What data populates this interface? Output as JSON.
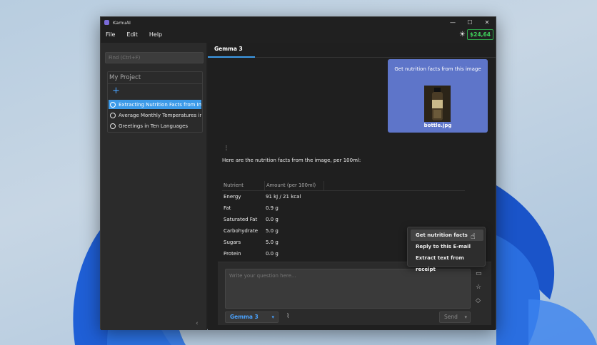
{
  "app": {
    "title": "KamuAI",
    "menu": [
      "File",
      "Edit",
      "Help"
    ],
    "credit": "$24,64",
    "accent_color": "#3d9be9",
    "credit_color": "#3fd35c"
  },
  "window_controls": {
    "minimize": "—",
    "maximize": "☐",
    "close": "✕"
  },
  "sidebar": {
    "search_placeholder": "Find (Ctrl+F)",
    "project_title": "My Project",
    "add_label": "+",
    "chats": [
      {
        "label": "Extracting Nutrition Facts from Im",
        "active": true
      },
      {
        "label": "Average Monthly Temperatures in",
        "active": false
      },
      {
        "label": "Greetings in Ten Languages",
        "active": false
      }
    ],
    "collapse_icon": "chevron-left-icon"
  },
  "tab": {
    "label": "Gemma 3"
  },
  "conversation": {
    "user_message": "Get nutrition facts from this image",
    "attachment_name": "bottle.jpg",
    "ai_intro": "Here are the nutrition facts from the image, per 100ml:",
    "table_headers": [
      "Nutrient",
      "Amount (per 100ml)"
    ],
    "table_rows": [
      [
        "Energy",
        "91 kJ / 21 kcal"
      ],
      [
        "Fat",
        "0.9 g"
      ],
      [
        "Saturated Fat",
        "0.0 g"
      ],
      [
        "Carbohydrate",
        "5.0 g"
      ],
      [
        "Sugars",
        "5.0 g"
      ],
      [
        "Protein",
        "0.0 g"
      ]
    ]
  },
  "prompt_menu": {
    "items": [
      "Get nutrition facts",
      "Reply to this E-mail",
      "Extract text from receipt"
    ],
    "hovered_index": 0
  },
  "composer": {
    "placeholder": "Write your question here...",
    "model": "Gemma 3",
    "send_label": "Send"
  }
}
